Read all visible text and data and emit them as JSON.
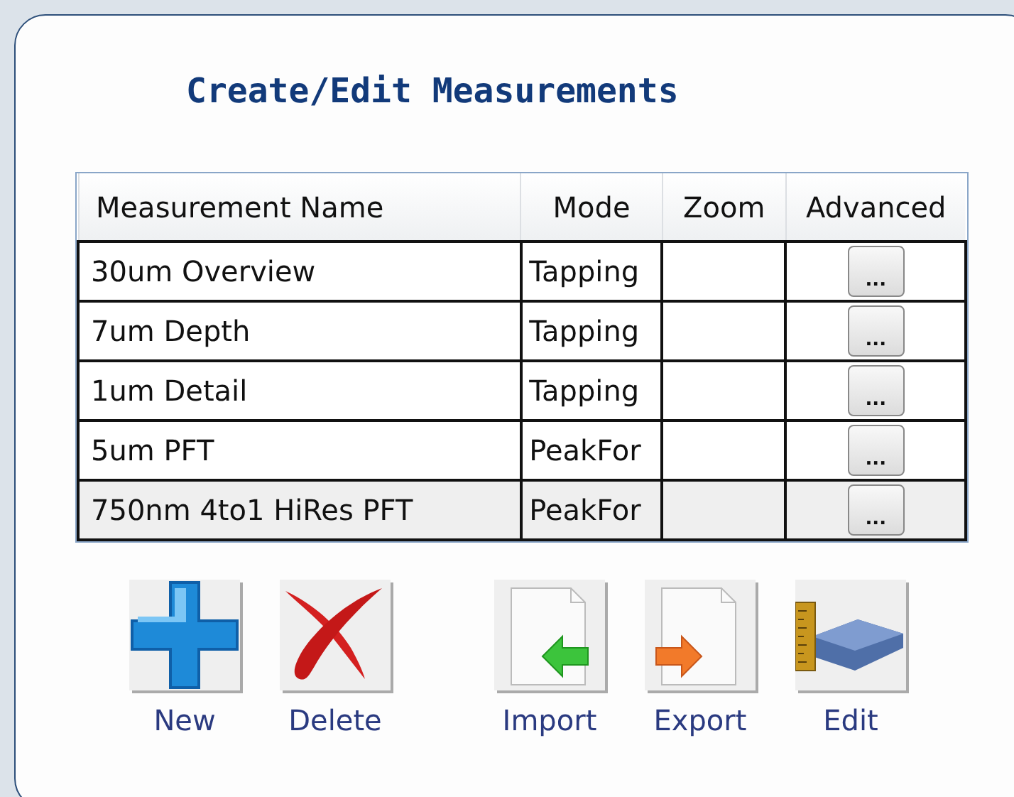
{
  "title": "Create/Edit Measurements",
  "table": {
    "columns": [
      "Measurement Name",
      "Mode",
      "Zoom",
      "Advanced"
    ],
    "rows": [
      {
        "name": "30um Overview",
        "mode": "Tapping",
        "advanced": "...",
        "selected": false
      },
      {
        "name": "7um Depth",
        "mode": "Tapping",
        "advanced": "...",
        "selected": false
      },
      {
        "name": "1um Detail",
        "mode": "Tapping",
        "advanced": "...",
        "selected": false
      },
      {
        "name": "5um PFT",
        "mode": "PeakFor",
        "advanced": "...",
        "selected": false
      },
      {
        "name": "750nm 4to1 HiRes PFT",
        "mode": "PeakFor",
        "advanced": "...",
        "selected": true
      }
    ]
  },
  "button_groups": [
    [
      {
        "kind": "new",
        "label": "New"
      },
      {
        "kind": "delete",
        "label": "Delete"
      }
    ],
    [
      {
        "kind": "import",
        "label": "Import"
      },
      {
        "kind": "export",
        "label": "Export"
      },
      {
        "kind": "edit",
        "label": "Edit"
      }
    ]
  ]
}
